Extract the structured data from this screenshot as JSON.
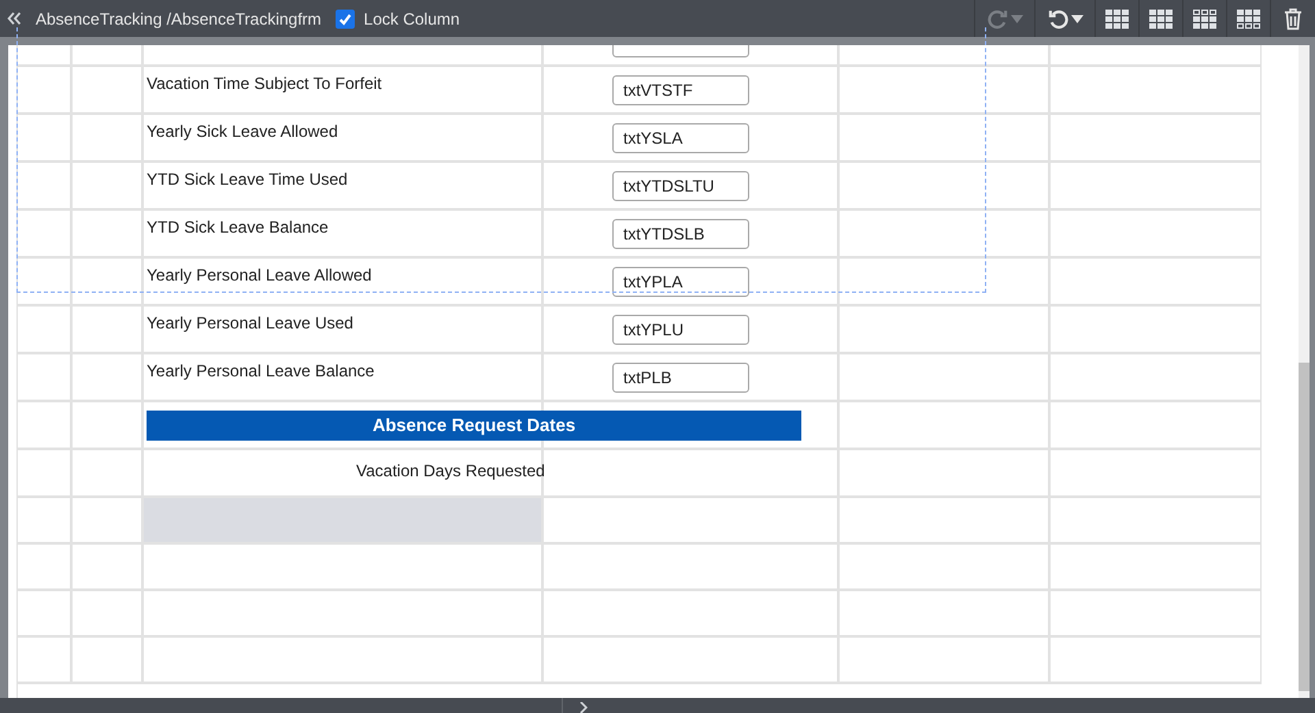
{
  "toolbar": {
    "breadcrumb": "AbsenceTracking /AbsenceTrackingfrm",
    "lock_column": {
      "label": "Lock Column",
      "checked": true
    },
    "redo_disabled": true
  },
  "rows": [
    {
      "kind": "field",
      "label": "Vacation Time Subject To Forfeit",
      "value": "txtVTSTF"
    },
    {
      "kind": "field",
      "label": "Yearly Sick Leave Allowed",
      "value": "txtYSLA"
    },
    {
      "kind": "field",
      "label": "YTD Sick Leave Time Used",
      "value": "txtYTDSLTU"
    },
    {
      "kind": "field",
      "label": "YTD Sick Leave Balance",
      "value": "txtYTDSLB"
    },
    {
      "kind": "field",
      "label": "Yearly Personal Leave Allowed",
      "value": "txtYPLA"
    },
    {
      "kind": "field",
      "label": "Yearly Personal Leave Used",
      "value": "txtYPLU"
    },
    {
      "kind": "field",
      "label": "Yearly Personal Leave Balance",
      "value": "txtPLB"
    },
    {
      "kind": "header",
      "label": "Absence Request Dates"
    },
    {
      "kind": "caption",
      "label": "Vacation Days Requested"
    },
    {
      "kind": "shaded"
    },
    {
      "kind": "empty"
    },
    {
      "kind": "empty"
    },
    {
      "kind": "empty"
    }
  ]
}
